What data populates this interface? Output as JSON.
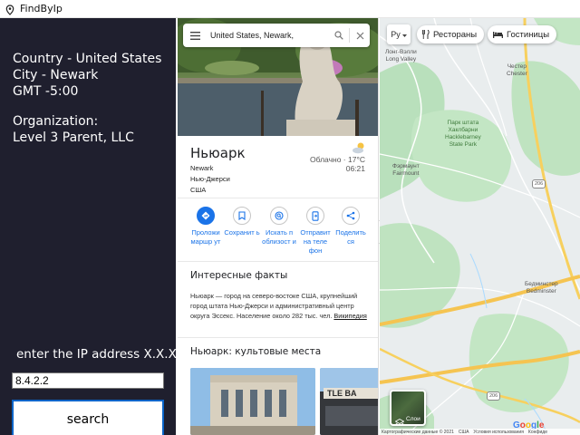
{
  "window": {
    "title": "FindByIp"
  },
  "result": {
    "country": "Country - United States",
    "city": "City - Newark",
    "gmt": "GMT -5:00",
    "organization_label": "Organization:",
    "organization": "Level 3 Parent, LLC"
  },
  "form": {
    "prompt": "enter the IP address X.X.X.X",
    "ip_value": "8.4.2.2",
    "search_label": "search",
    "button_border_color": "#0a64c8"
  },
  "maps": {
    "search_query": "United States, Newark,",
    "place": {
      "name": "Ньюарк",
      "address_lines": [
        "Newark",
        "Нью-Джерси",
        "США"
      ],
      "weather": "Облачно · 17°C",
      "time": "06:21"
    },
    "actions": [
      {
        "label": "Проложи маршр ут",
        "icon": "directions-icon"
      },
      {
        "label": "Сохранит ь",
        "icon": "bookmark-icon"
      },
      {
        "label": "Искать п облизост и",
        "icon": "nearby-icon"
      },
      {
        "label": "Отправит на теле фон",
        "icon": "send-to-phone-icon"
      },
      {
        "label": "Поделить ся",
        "icon": "share-icon"
      }
    ],
    "facts_heading": "Интересные факты",
    "facts_text": "Ньюарк — город на северо-востоке США, крупнейший город штата Нью-Джерси и административный центр округа Эссекс. Население около 282 тыс. чел.",
    "facts_link": "Википедия",
    "places_heading": "Ньюарк: культовые места",
    "accent_color": "#1a73e8"
  },
  "map": {
    "language_button": "Ру",
    "chips": [
      {
        "label": "Рестораны",
        "icon": "restaurant-icon"
      },
      {
        "label": "Гостиницы",
        "icon": "hotel-icon"
      }
    ],
    "labels": {
      "long_valley": "Лонг-Вэлли\nLong Valley",
      "chester": "Честер\nChester",
      "hacklebarney": "Парк штата\nХаклбарни\nHacklebarney\nState Park",
      "fairmount": "Фэрмаунт\nFairmount",
      "bedminster": "Бедминстер\nBedminster"
    },
    "route_shields": [
      "206",
      "206"
    ],
    "layers_label": "Слои",
    "google": "Google",
    "attribution": [
      "Картографические данные © 2021",
      "США",
      "Условия использования",
      "Конфиде"
    ],
    "colors": {
      "land": "#eaeef0",
      "green": "#b7dfb9",
      "road": "#f5c451",
      "water": "#aadaff"
    }
  }
}
